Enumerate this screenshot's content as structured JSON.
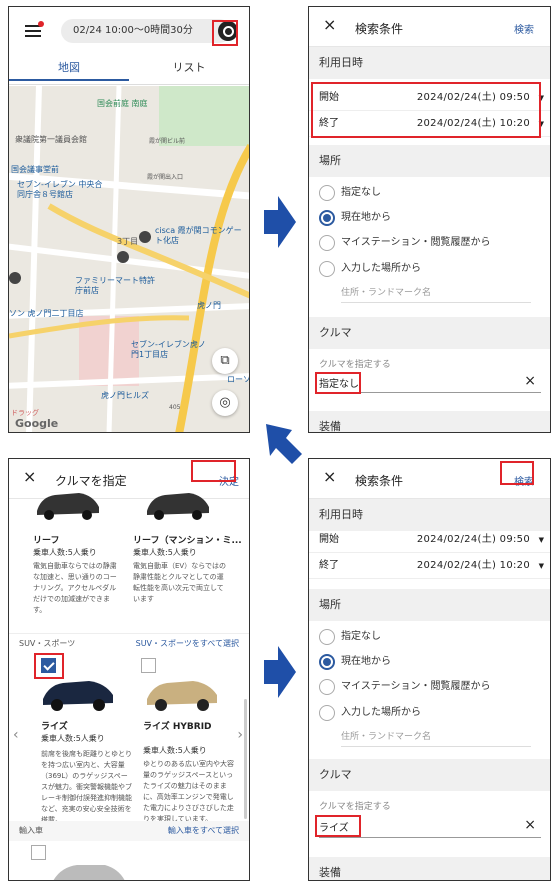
{
  "map_screen": {
    "time_display": "02/24 10:00〜0時間30分",
    "tabs": [
      "地図",
      "リスト"
    ],
    "map_labels": [
      "国会前庭 南庭",
      "衆議院第一議員会館",
      "霞が関ビル前",
      "国会議事堂前",
      "霞が関出入口",
      "セブン-イレブン 中央合同庁舎８号館店",
      "cisca 霞が関コモンゲート化店",
      "3丁目",
      "ファミリーマート特許庁前店",
      "ソン 虎ノ門二丁目店",
      "虎ノ門",
      "セブン-イレブン虎ノ門1丁目店",
      "虎ノ門ヒルズ",
      "405",
      "ローソン",
      "ドラッグ",
      "Google"
    ]
  },
  "search_conditions_1": {
    "close_icon": "×",
    "title": "検索条件",
    "action": "検索",
    "date_section": "利用日時",
    "start_label": "開始",
    "start_value": "2024/02/24(土) 09:50",
    "end_label": "終了",
    "end_value": "2024/02/24(土) 10:20",
    "place_section": "場所",
    "place_options": [
      "指定なし",
      "現在地から",
      "マイステーション・閲覧履歴から",
      "入力した場所から"
    ],
    "place_selected_index": 1,
    "address_placeholder": "住所・ランドマーク名",
    "car_section": "クルマ",
    "car_sublabel": "クルマを指定する",
    "car_value": "指定なし",
    "car_clear": "×",
    "equipment_section": "装備"
  },
  "car_selection": {
    "close_icon": "×",
    "title": "クルマを指定",
    "action": "決定",
    "leaf_cards": [
      {
        "name": "リーフ",
        "capacity": "乗車人数:5人乗り",
        "desc": "電気自動車ならではの静粛な加速と、思い通りのコーナリング。アクセルペダルだけでの加減速ができます。"
      },
      {
        "name": "リーフ（マンション・ミ...",
        "capacity": "乗車人数:5人乗り",
        "desc": "電気自動車（EV）ならではの静粛性能とクルマとしての運転性能を高い次元で両立しています"
      }
    ],
    "suv_category": "SUV・スポーツ",
    "suv_select_all": "SUV・スポーツをすべて選択",
    "suv_cards": [
      {
        "name": "ライズ",
        "capacity": "乗車人数:5人乗り",
        "desc": "前席を後席も距離りとゆとりを持つ広い室内と、大容量（369L）のラゲッジスペースが魅力。衝突警報機能やブレーキ制御付誤発進抑制機能など、充実の安心安全技術を搭載。",
        "checked": true
      },
      {
        "name": "ライズ HYBRID",
        "capacity": "乗車人数:5人乗り",
        "desc": "ゆとりのある広い室内や大容量のラゲッジスペースといったライズの魅力はそのままに、高効率エンジンで発電した電力によりさびさびした走りを実現しています。",
        "checked": false
      }
    ],
    "import_category": "輸入車",
    "import_select_all": "輸入車をすべて選択"
  },
  "search_conditions_2": {
    "close_icon": "×",
    "title": "検索条件",
    "action": "検索",
    "date_section": "利用日時",
    "start_label": "開始",
    "start_value": "2024/02/24(土) 09:50",
    "end_label": "終了",
    "end_value": "2024/02/24(土) 10:20",
    "place_section": "場所",
    "place_options": [
      "指定なし",
      "現在地から",
      "マイステーション・閲覧履歴から",
      "入力した場所から"
    ],
    "place_selected_index": 1,
    "address_placeholder": "住所・ランドマーク名",
    "car_section": "クルマ",
    "car_sublabel": "クルマを指定する",
    "car_value": "ライズ",
    "car_clear": "×",
    "equipment_section": "装備"
  },
  "colors": {
    "accent": "#2c5aa0",
    "highlight": "#e0242a",
    "arrow": "#1f4fa8"
  }
}
